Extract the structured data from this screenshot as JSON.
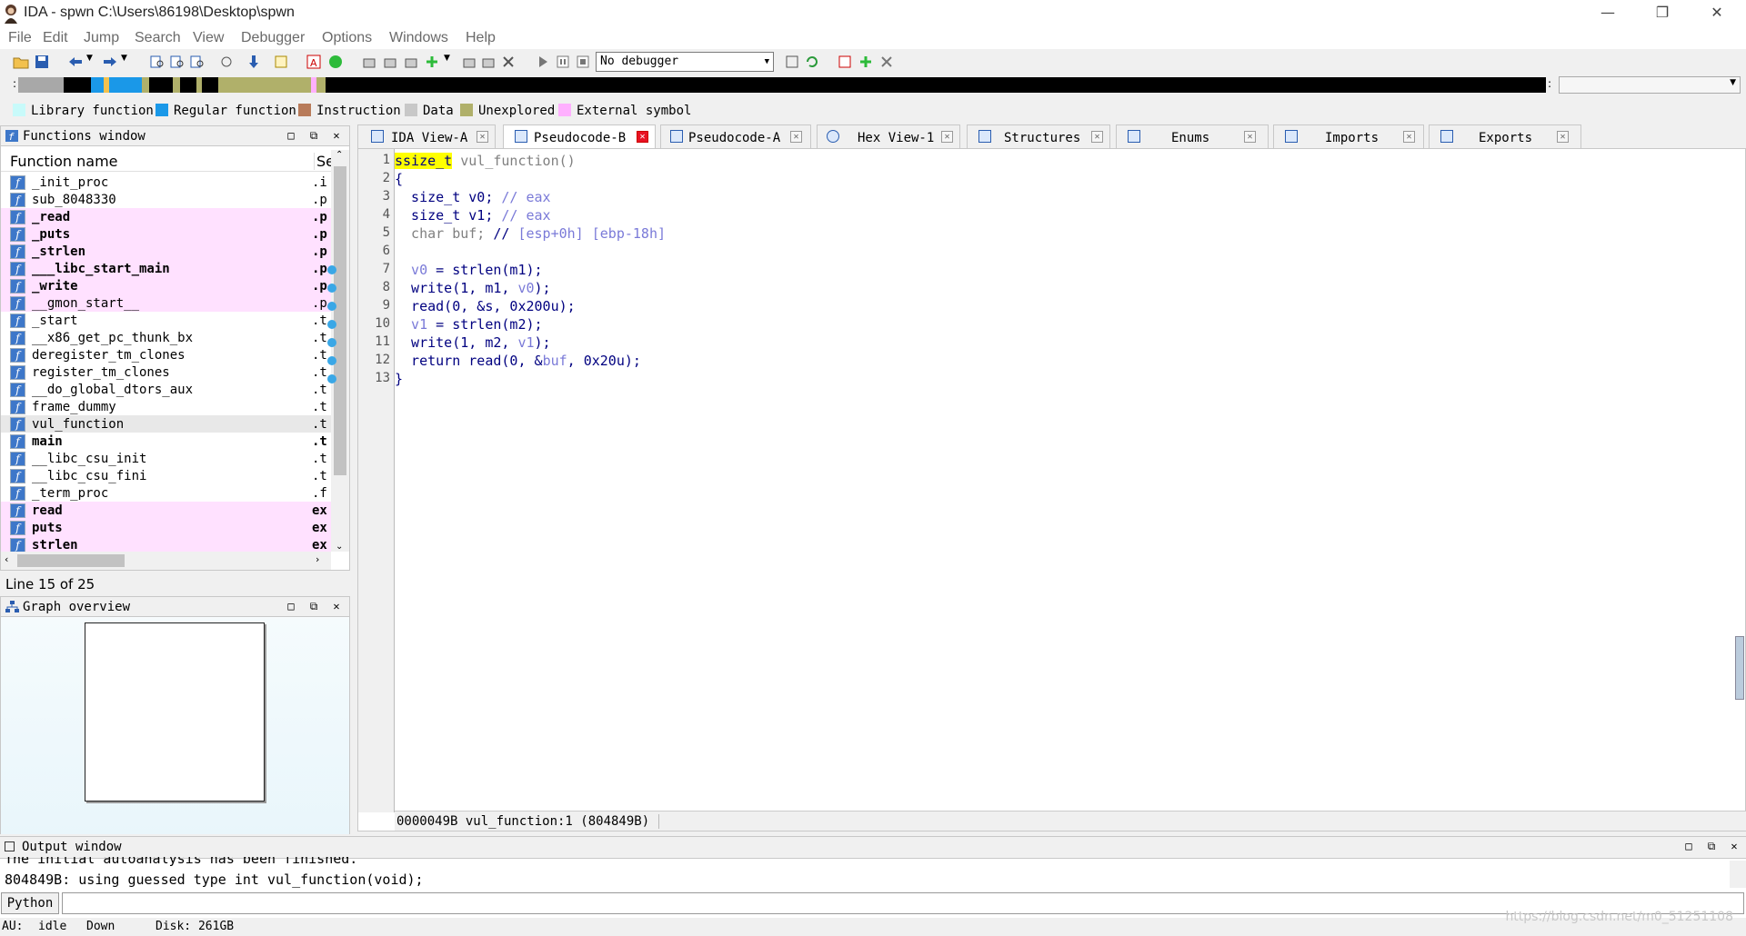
{
  "window": {
    "title": "IDA - spwn C:\\Users\\86198\\Desktop\\spwn",
    "minimize": "—",
    "restore": "❐",
    "close": "✕"
  },
  "menu": [
    "File",
    "Edit",
    "Jump",
    "Search",
    "View",
    "Debugger",
    "Options",
    "Windows",
    "Help"
  ],
  "toolbar": {
    "debugger_value": "No debugger"
  },
  "legend": [
    {
      "label": "Library function",
      "color": "#c8fafa"
    },
    {
      "label": "Regular function",
      "color": "#1a98e8"
    },
    {
      "label": "Instruction",
      "color": "#b87b5a"
    },
    {
      "label": "Data",
      "color": "#c8c8c8"
    },
    {
      "label": "Unexplored",
      "color": "#b0b06a"
    },
    {
      "label": "External symbol",
      "color": "#ffb0ff"
    }
  ],
  "functions_window": {
    "title": "Functions window",
    "col_name": "Function name",
    "col_segment": "Se",
    "rows": [
      {
        "name": "_init_proc",
        "seg": ".i",
        "style": ""
      },
      {
        "name": "sub_8048330",
        "seg": ".p",
        "style": ""
      },
      {
        "name": "_read",
        "seg": ".p",
        "style": "ext bold"
      },
      {
        "name": "_puts",
        "seg": ".p",
        "style": "ext bold"
      },
      {
        "name": "_strlen",
        "seg": ".p",
        "style": "ext bold"
      },
      {
        "name": "___libc_start_main",
        "seg": ".p",
        "style": "ext bold"
      },
      {
        "name": "_write",
        "seg": ".p",
        "style": "ext bold"
      },
      {
        "name": "__gmon_start__",
        "seg": ".p",
        "style": "ext"
      },
      {
        "name": "_start",
        "seg": ".t",
        "style": ""
      },
      {
        "name": "__x86_get_pc_thunk_bx",
        "seg": ".t",
        "style": ""
      },
      {
        "name": "deregister_tm_clones",
        "seg": ".t",
        "style": ""
      },
      {
        "name": "register_tm_clones",
        "seg": ".t",
        "style": ""
      },
      {
        "name": "__do_global_dtors_aux",
        "seg": ".t",
        "style": ""
      },
      {
        "name": "frame_dummy",
        "seg": ".t",
        "style": ""
      },
      {
        "name": "vul_function",
        "seg": ".t",
        "style": "sel"
      },
      {
        "name": "main",
        "seg": ".t",
        "style": "bold"
      },
      {
        "name": "__libc_csu_init",
        "seg": ".t",
        "style": ""
      },
      {
        "name": "__libc_csu_fini",
        "seg": ".t",
        "style": ""
      },
      {
        "name": "_term_proc",
        "seg": ".f",
        "style": ""
      },
      {
        "name": "read",
        "seg": "ex",
        "style": "ext bold"
      },
      {
        "name": "puts",
        "seg": "ex",
        "style": "ext bold"
      },
      {
        "name": "strlen",
        "seg": "ex",
        "style": "ext bold"
      }
    ],
    "line_status": "Line 15 of 25"
  },
  "graph_overview": {
    "title": "Graph overview"
  },
  "tabs": [
    {
      "label": "IDA View-A",
      "active": false
    },
    {
      "label": "Pseudocode-B",
      "active": true
    },
    {
      "label": "Pseudocode-A",
      "active": false
    },
    {
      "label": "Hex View-1",
      "active": false
    },
    {
      "label": "Structures",
      "active": false
    },
    {
      "label": "Enums",
      "active": false
    },
    {
      "label": "Imports",
      "active": false
    },
    {
      "label": "Exports",
      "active": false
    }
  ],
  "code": {
    "line_numbers": [
      "1",
      "2",
      "3",
      "4",
      "5",
      "6",
      "7",
      "8",
      "9",
      "10",
      "11",
      "12",
      "13"
    ],
    "breakpoint_lines": [
      7,
      8,
      9,
      10,
      11,
      12,
      13
    ],
    "status": "0000049B vul_function:1 (804849B)"
  },
  "output": {
    "title": "Output window",
    "lines": [
      "The initial autoanalysis has been finished.",
      "804849B: using guessed type int vul_function(void);"
    ],
    "python_label": "Python"
  },
  "status": {
    "au": "AU:",
    "state": "idle",
    "direction": "Down",
    "disk": "Disk: 261GB"
  },
  "watermark": "https://blog.csdn.net/m0_51251108"
}
